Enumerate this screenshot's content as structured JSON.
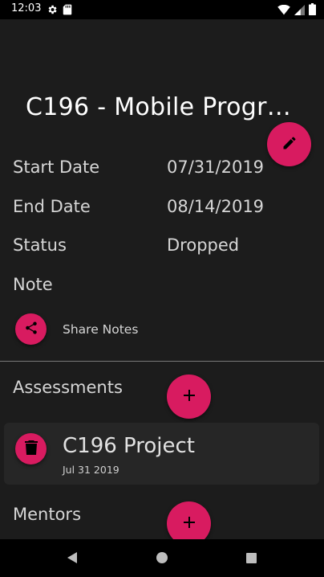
{
  "status_bar": {
    "time": "12:03",
    "left_icons": [
      "gear-icon",
      "sd-card-icon"
    ],
    "right_icons": [
      "wifi-icon",
      "signal-icon",
      "battery-icon"
    ]
  },
  "course": {
    "title": "C196 - Mobile Progra..."
  },
  "details": {
    "start_label": "Start Date",
    "start_value": "07/31/2019",
    "end_label": "End Date",
    "end_value": "08/14/2019",
    "status_label": "Status",
    "status_value": "Dropped",
    "note_label": "Note"
  },
  "share": {
    "label": "Share Notes"
  },
  "assessments": {
    "title": "Assessments",
    "items": [
      {
        "name": "C196 Project",
        "date": "Jul 31 2019"
      }
    ]
  },
  "mentors": {
    "title": "Mentors"
  },
  "colors": {
    "accent": "#d81b60",
    "background": "#1c1c1c",
    "card": "#262626"
  }
}
